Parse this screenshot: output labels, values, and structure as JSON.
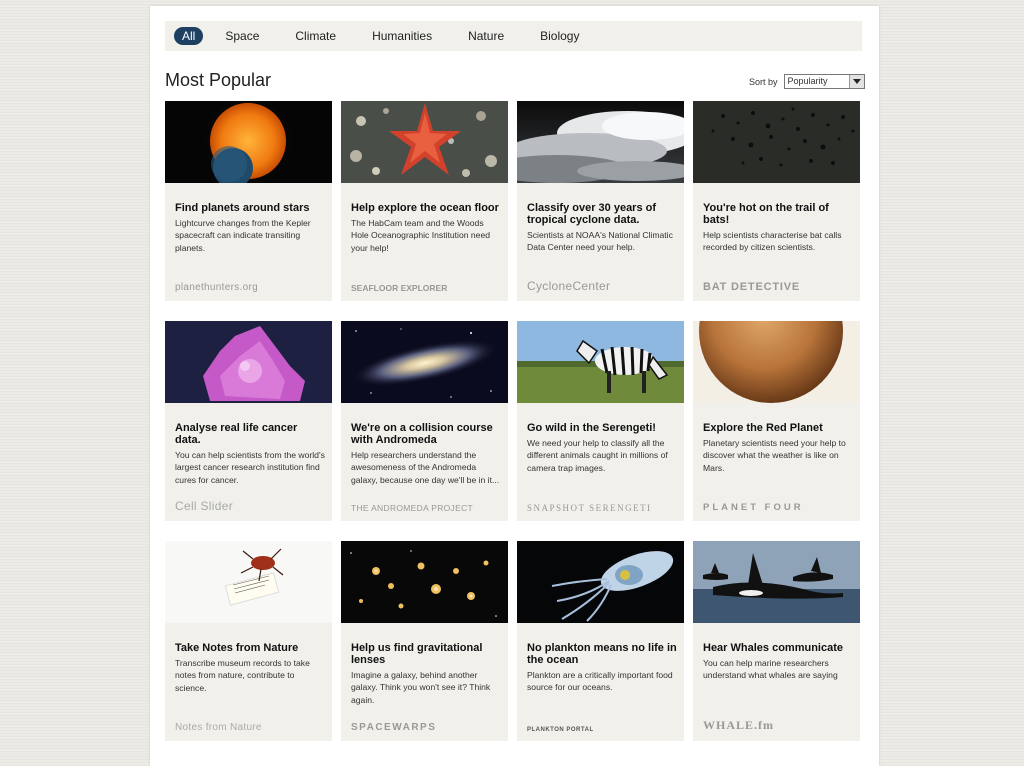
{
  "filters": [
    "All",
    "Space",
    "Climate",
    "Humanities",
    "Nature",
    "Biology"
  ],
  "active_filter": "All",
  "page_title": "Most Popular",
  "sort": {
    "label": "Sort by",
    "selected": "Popularity"
  },
  "projects": [
    {
      "title": "Find planets around stars",
      "description": "Lightcurve changes from the Kepler spacecraft can indicate transiting planets.",
      "logo": "planethunters.org"
    },
    {
      "title": "Help explore the ocean floor",
      "description": "The HabCam team and the Woods Hole Oceanographic Institution need your help!",
      "logo": "SEAFLOOR EXPLORER"
    },
    {
      "title": "Classify over 30 years of tropical cyclone data.",
      "description": "Scientists at NOAA's National Climatic Data Center need your help.",
      "logo": "CycloneCenter"
    },
    {
      "title": "You're hot on the trail of bats!",
      "description": "Help scientists characterise bat calls recorded by citizen scientists.",
      "logo": "BAT DETECTIVE"
    },
    {
      "title": "Analyse real life cancer data.",
      "description": "You can help scientists from the world's largest cancer research institution find cures for cancer.",
      "logo": "Cell Slider"
    },
    {
      "title": "We're on a collision course with Andromeda",
      "description": "Help researchers understand the awesomeness of the Andromeda galaxy, because one day we'll be in it...",
      "logo": "THE ANDROMEDA PROJECT"
    },
    {
      "title": "Go wild in the Serengeti!",
      "description": "We need your help to classify all the different animals caught in millions of camera trap images.",
      "logo": "SNAPSHOT SERENGETI"
    },
    {
      "title": "Explore the Red Planet",
      "description": "Planetary scientists need your help to discover what the weather is like on Mars.",
      "logo": "PLANET FOUR"
    },
    {
      "title": "Take Notes from Nature",
      "description": "Transcribe museum records to take notes from nature, contribute to science.",
      "logo": "Notes from Nature"
    },
    {
      "title": "Help us find gravitational lenses",
      "description": "Imagine a galaxy, behind another galaxy. Think you won't see it? Think again.",
      "logo": "SPACEWARPS"
    },
    {
      "title": "No plankton means no life in the ocean",
      "description": "Plankton are a critically important food source for our oceans.",
      "logo": "PLANKTON PORTAL"
    },
    {
      "title": "Hear Whales communicate",
      "description": "You can help marine researchers understand what whales are saying",
      "logo": "WHALE.fm"
    }
  ]
}
